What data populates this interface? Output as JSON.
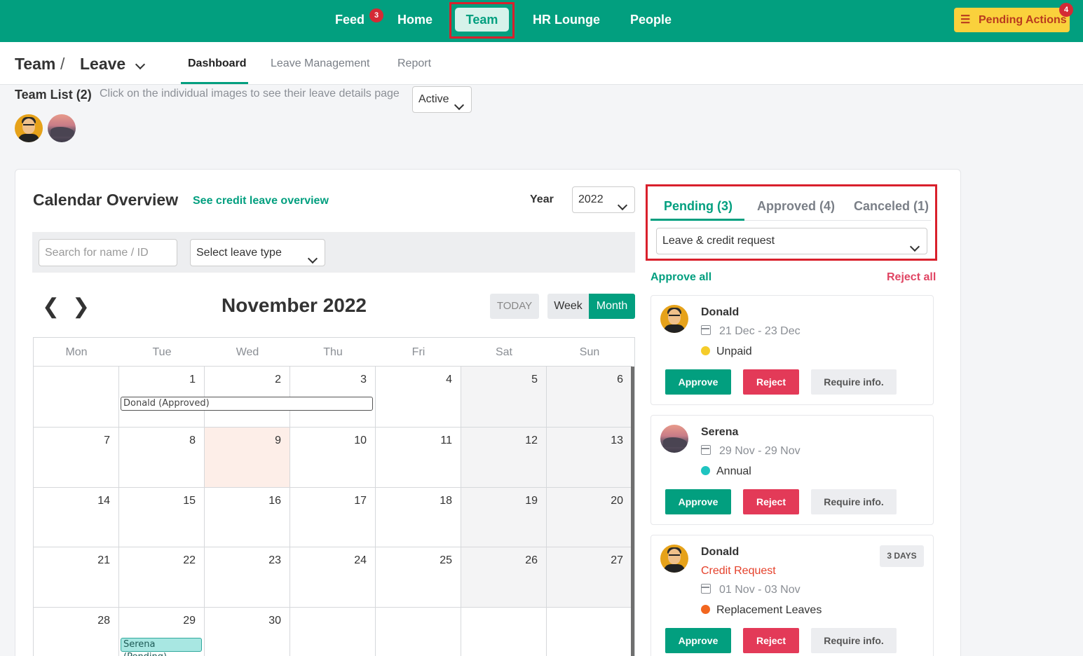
{
  "topnav": {
    "items": [
      {
        "label": "Feed",
        "badge": "3"
      },
      {
        "label": "Home"
      },
      {
        "label": "Team"
      },
      {
        "label": "HR Lounge"
      },
      {
        "label": "People"
      }
    ],
    "pending_actions": {
      "label": "Pending Actions",
      "badge": "4",
      "icon": "checklist-icon"
    },
    "colors": {
      "brand": "#029f7f",
      "badge": "#d42a35",
      "highlight": "#d9202c",
      "pending_bg": "#fad13c"
    }
  },
  "breadcrumb": {
    "root": "Team",
    "separator": "/",
    "current": "Leave"
  },
  "subtabs": [
    "Dashboard",
    "Leave Management",
    "Report"
  ],
  "team_list": {
    "title": "Team List (2)",
    "hint": "Click on the individual images to see their leave details page",
    "status_filter": "Active"
  },
  "calendar_overview": {
    "title": "Calendar Overview",
    "credit_link": "See credit leave overview",
    "year_label": "Year",
    "year": "2022",
    "search_placeholder": "Search for name / ID",
    "leave_type_placeholder": "Select leave type",
    "month_title": "November 2022",
    "today_label": "TODAY",
    "week_label": "Week",
    "month_label": "Month",
    "weekdays": [
      "Mon",
      "Tue",
      "Wed",
      "Thu",
      "Fri",
      "Sat",
      "Sun"
    ],
    "weeks": [
      [
        "",
        "1",
        "2",
        "3",
        "4",
        "5",
        "6"
      ],
      [
        "7",
        "8",
        "9",
        "10",
        "11",
        "12",
        "13"
      ],
      [
        "14",
        "15",
        "16",
        "17",
        "18",
        "19",
        "20"
      ],
      [
        "21",
        "22",
        "23",
        "24",
        "25",
        "26",
        "27"
      ],
      [
        "28",
        "29",
        "30",
        "",
        "",
        "",
        ""
      ]
    ],
    "events": [
      {
        "label": "Donald (Approved)",
        "status": "approved"
      },
      {
        "label": "Serena (Pending)",
        "status": "pending"
      }
    ]
  },
  "requests_panel": {
    "tabs": [
      "Pending (3)",
      "Approved (4)",
      "Canceled (1)"
    ],
    "filter": "Leave & credit request",
    "approve_all": "Approve all",
    "reject_all": "Reject all",
    "buttons": {
      "approve": "Approve",
      "reject": "Reject",
      "info": "Require info."
    },
    "requests": [
      {
        "name": "Donald",
        "dates": "21 Dec - 23 Dec",
        "type": "Unpaid",
        "type_color": "#f5cc2a"
      },
      {
        "name": "Serena",
        "dates": "29 Nov - 29 Nov",
        "type": "Annual",
        "type_color": "#1fc4c0"
      },
      {
        "name": "Donald",
        "subtitle": "Credit Request",
        "dates": "01 Nov - 03 Nov",
        "type": "Replacement Leaves",
        "type_color": "#f2661f",
        "badge": "3 DAYS"
      }
    ]
  }
}
